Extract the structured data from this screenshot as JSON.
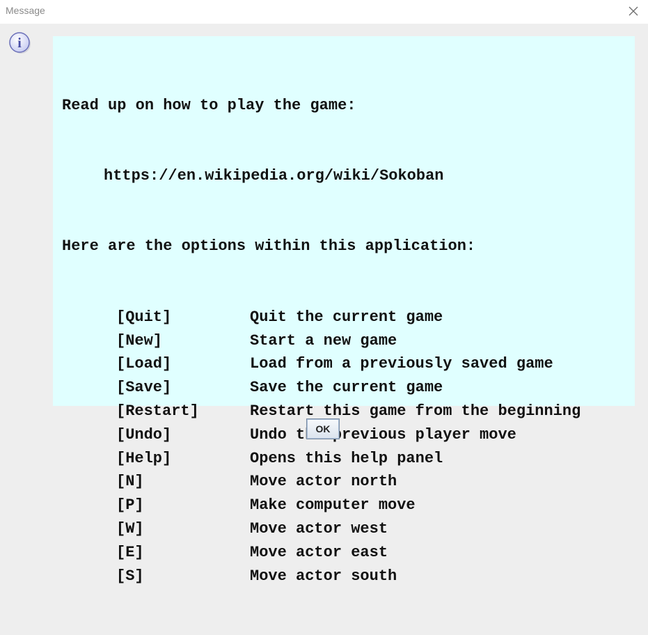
{
  "window": {
    "title": "Message",
    "close_icon": "close-icon"
  },
  "dialog": {
    "icon": "info-icon",
    "icon_glyph": "i",
    "intro_line": "Read up on how to play the game:",
    "url": "https://en.wikipedia.org/wiki/Sokoban",
    "options_heading": "Here are the options within this application:",
    "options": [
      {
        "key": "[Quit]",
        "description": "Quit the current game"
      },
      {
        "key": "[New]",
        "description": "Start a new game"
      },
      {
        "key": "[Load]",
        "description": "Load from a previously saved game"
      },
      {
        "key": "[Save]",
        "description": "Save the current game"
      },
      {
        "key": "[Restart]",
        "description": "Restart this game from the beginning"
      },
      {
        "key": "[Undo]",
        "description": "Undo the previous player move"
      },
      {
        "key": "[Help]",
        "description": "Opens this help panel"
      },
      {
        "key": "[N]",
        "description": "Move actor north"
      },
      {
        "key": "[P]",
        "description": "Make computer move"
      },
      {
        "key": "[W]",
        "description": "Move actor west"
      },
      {
        "key": "[E]",
        "description": "Move actor east"
      },
      {
        "key": "[S]",
        "description": "Move actor south"
      }
    ],
    "ok_label": "OK",
    "panel_color": "#e0ffff"
  }
}
